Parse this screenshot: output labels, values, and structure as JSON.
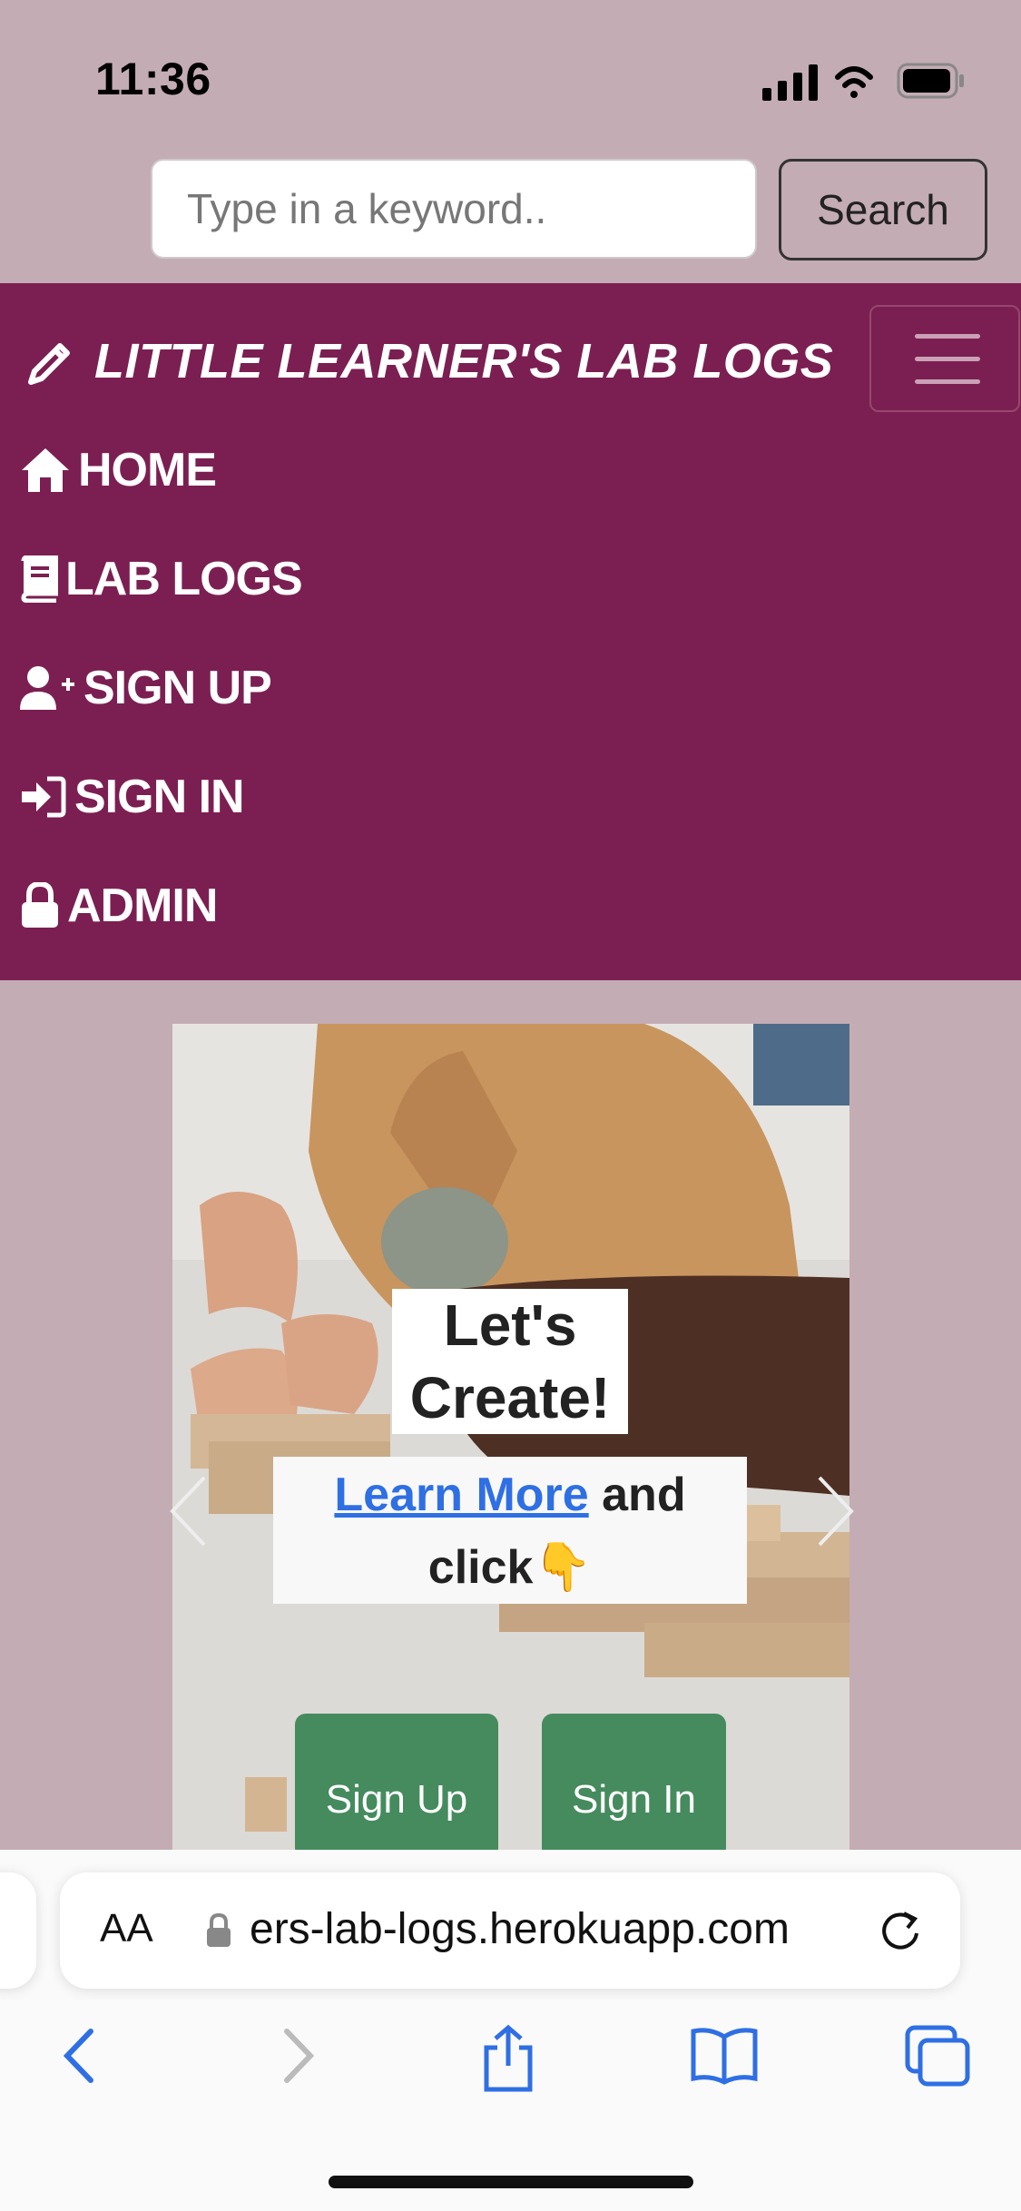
{
  "status_bar": {
    "time": "11:36"
  },
  "search": {
    "placeholder": "Type in a keyword..",
    "button_label": "Search"
  },
  "navbar": {
    "brand": "LITTLE LEARNER'S LAB LOGS",
    "items": [
      {
        "label": "HOME",
        "icon": "home-icon"
      },
      {
        "label": "LAB LOGS",
        "icon": "book-icon"
      },
      {
        "label": "SIGN UP",
        "icon": "user-plus-icon"
      },
      {
        "label": "SIGN IN",
        "icon": "sign-in-icon"
      },
      {
        "label": "ADMIN",
        "icon": "lock-icon"
      }
    ]
  },
  "hero": {
    "title": "Let's Create!",
    "link_text": "Learn More",
    "subtitle_rest": " and",
    "subtitle_line2": "click",
    "emoji": "👇",
    "buttons": {
      "sign_up": "Sign Up",
      "sign_in": "Sign In"
    }
  },
  "browser": {
    "aa": "AA",
    "url": "ers-lab-logs.herokuapp.com"
  },
  "colors": {
    "navbar": "#7b1f52",
    "page_bg": "#c4acb4",
    "cta": "#458b5d",
    "link": "#2f6fe4"
  }
}
